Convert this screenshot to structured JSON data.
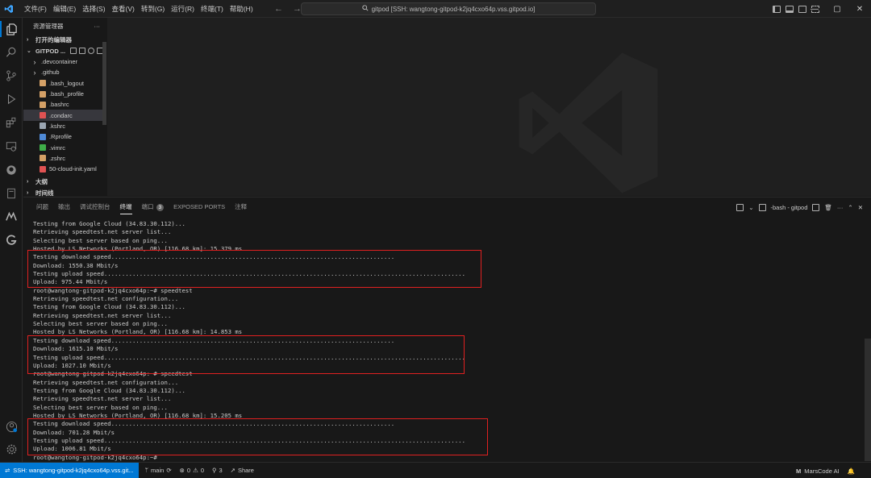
{
  "menu": [
    "文件(F)",
    "编辑(E)",
    "选择(S)",
    "查看(V)",
    "转到(G)",
    "运行(R)",
    "终端(T)",
    "帮助(H)"
  ],
  "command_center": {
    "text": "gitpod [SSH: wangtong-gitpod-k2jq4cxo64p.vss.gitpod.io]"
  },
  "sidebar": {
    "header": "资源管理器",
    "more": "···",
    "open_editors": "打开的编辑器",
    "folder": "GITPOD ...",
    "items": [
      {
        "label": ".devcontainer",
        "kind": "folder",
        "icon": "chevron-right-icon"
      },
      {
        "label": ".github",
        "kind": "folder",
        "icon": "chevron-right-icon"
      },
      {
        "label": ".bash_logout",
        "kind": "file",
        "icon": "shell-icon"
      },
      {
        "label": ".bash_profile",
        "kind": "file",
        "icon": "shell-icon"
      },
      {
        "label": ".bashrc",
        "kind": "file",
        "icon": "shell-icon"
      },
      {
        "label": ".condarc",
        "kind": "file",
        "icon": "yaml-icon"
      },
      {
        "label": ".kshrc",
        "kind": "file",
        "icon": "file-icon"
      },
      {
        "label": ".Rprofile",
        "kind": "file",
        "icon": "r-icon"
      },
      {
        "label": ".vimrc",
        "kind": "file",
        "icon": "vim-icon"
      },
      {
        "label": ".zshrc",
        "kind": "file",
        "icon": "shell-icon"
      },
      {
        "label": "50-cloud-init.yaml",
        "kind": "file",
        "icon": "yaml-icon"
      }
    ],
    "outline": "大纲",
    "timeline": "时间线"
  },
  "panel": {
    "tabs": [
      "问题",
      "输出",
      "调试控制台",
      "终端",
      "端口",
      "EXPOSED PORTS",
      "注释"
    ],
    "ports_badge": "3",
    "terminal_name": "-bash - gitpod"
  },
  "terminal_lines": [
    "Testing from Google Cloud (34.83.30.112)...",
    "Retrieving speedtest.net server list...",
    "Selecting best server based on ping...",
    "Hosted by LS Networks (Portland, OR) [116.68 km]: 15.379 ms",
    "Testing download speed................................................................................",
    "Download: 1550.38 Mbit/s",
    "Testing upload speed......................................................................................................",
    "Upload: 975.44 Mbit/s",
    "root@wangtong-gitpod-k2jq4cxo64p:~# speedtest",
    "Retrieving speedtest.net configuration...",
    "Testing from Google Cloud (34.83.30.112)...",
    "Retrieving speedtest.net server list...",
    "Selecting best server based on ping...",
    "Hosted by LS Networks (Portland, OR) [116.68 km]: 14.853 ms",
    "Testing download speed................................................................................",
    "Download: 1615.10 Mbit/s",
    "Testing upload speed......................................................................................................",
    "Upload: 1027.10 Mbit/s",
    "root@wangtong-gitpod-k2jq4cxo64p:~# speedtest",
    "Retrieving speedtest.net configuration...",
    "Testing from Google Cloud (34.83.30.112)...",
    "Retrieving speedtest.net server list...",
    "Selecting best server based on ping...",
    "Hosted by LS Networks (Portland, OR) [116.68 km]: 15.205 ms",
    "Testing download speed................................................................................",
    "Download: 701.28 Mbit/s",
    "Testing upload speed......................................................................................................",
    "Upload: 1006.81 Mbit/s",
    "root@wangtong-gitpod-k2jq4cxo64p:~# "
  ],
  "statusbar": {
    "remote": "SSH: wangtong-gitpod-k2jq4cxo64p.vss.git...",
    "branch": "main",
    "errors": "0",
    "warnings": "0",
    "ports": "3",
    "share": "Share",
    "assistant": "MarsCode AI"
  },
  "colors": {
    "accent": "#0078d4",
    "highlight_box": "#e02020",
    "background": "#181818"
  }
}
